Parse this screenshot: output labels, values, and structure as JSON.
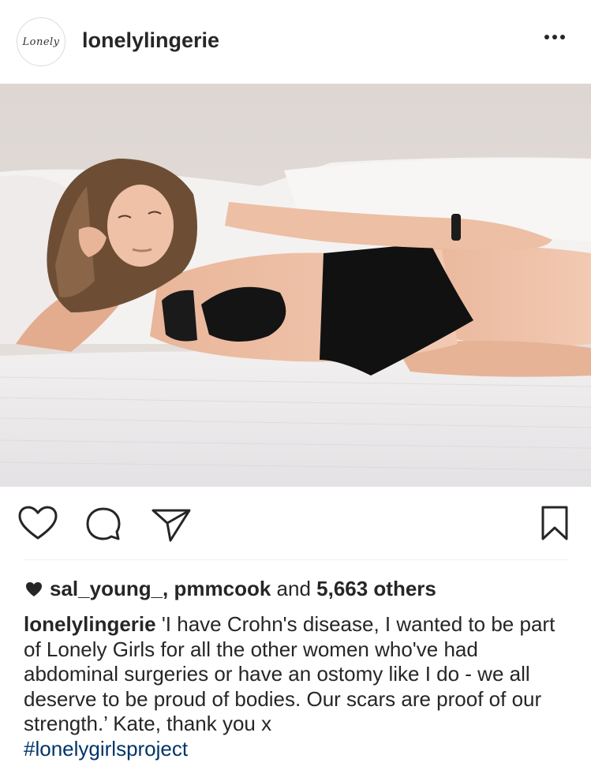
{
  "post": {
    "avatar_text": "Lonely",
    "username": "lonelylingerie",
    "more_icon": "more-horizontal-icon"
  },
  "actions": {
    "like_icon": "heart-outline-icon",
    "comment_icon": "comment-icon",
    "share_icon": "paper-plane-icon",
    "save_icon": "bookmark-icon"
  },
  "likes": {
    "heart_icon": "heart-filled-icon",
    "users": "sal_young_, pmmcook",
    "and_text": " and ",
    "others": "5,663 others"
  },
  "caption": {
    "username": "lonelylingerie",
    "text": "'I have Crohn's disease, I wanted to be part of Lonely Girls for all the other women who've had abdominal surgeries or have an ostomy like I do - we all deserve to be proud of bodies. Our scars are proof of our strength.’ Kate, thank you x",
    "hashtag": "#lonelygirlsproject"
  },
  "colors": {
    "text": "#262626",
    "hashtag": "#003569",
    "divider": "#efefef"
  }
}
